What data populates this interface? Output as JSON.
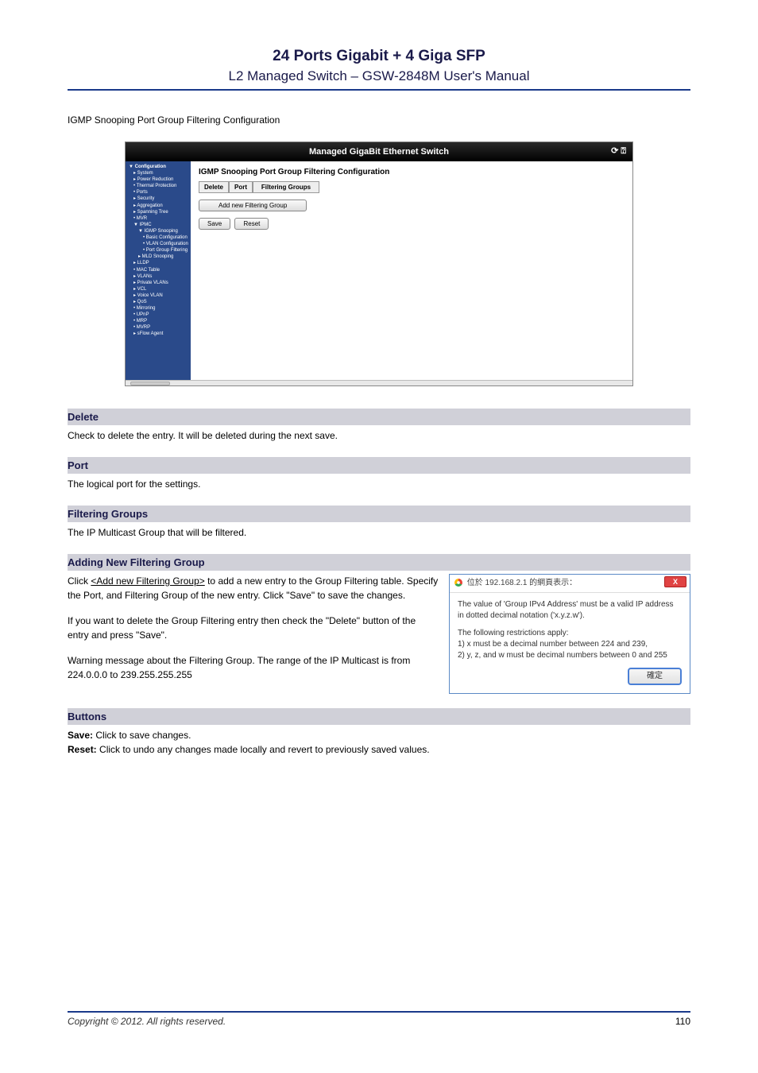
{
  "document": {
    "title": "24 Ports Gigabit + 4 Giga SFP",
    "subtitle": "L2 Managed Switch – GSW-2848M User's Manual",
    "intro": "IGMP Snooping Port Group Filtering Configuration",
    "footer_left": "Copyright © 2012. All rights reserved.",
    "footer_right": "110"
  },
  "switchui": {
    "header": "Managed GigaBit Ethernet Switch",
    "pane_title": "IGMP Snooping Port Group Filtering Configuration",
    "table": {
      "c1": "Delete",
      "c2": "Port",
      "c3": "Filtering Groups"
    },
    "btn_add": "Add new Filtering Group",
    "btn_save": "Save",
    "btn_reset": "Reset",
    "sidebar": [
      {
        "l": 1,
        "t": "▼ Configuration",
        "b": true
      },
      {
        "l": 2,
        "t": "▸ System"
      },
      {
        "l": 2,
        "t": "▸ Power Reduction"
      },
      {
        "l": 2,
        "t": "• Thermal Protection"
      },
      {
        "l": 2,
        "t": "• Ports"
      },
      {
        "l": 2,
        "t": "▸ Security"
      },
      {
        "l": 2,
        "t": "▸ Aggregation"
      },
      {
        "l": 2,
        "t": "▸ Spanning Tree"
      },
      {
        "l": 2,
        "t": "• MVR"
      },
      {
        "l": 2,
        "t": "▼ IPMC"
      },
      {
        "l": 3,
        "t": "▼ IGMP Snooping"
      },
      {
        "l": 4,
        "t": "• Basic Configuration"
      },
      {
        "l": 4,
        "t": "• VLAN Configuration"
      },
      {
        "l": 4,
        "t": "• Port Group Filtering"
      },
      {
        "l": 3,
        "t": "▸ MLD Snooping"
      },
      {
        "l": 2,
        "t": "▸ LLDP"
      },
      {
        "l": 2,
        "t": "• MAC Table"
      },
      {
        "l": 2,
        "t": "▸ VLANs"
      },
      {
        "l": 2,
        "t": "▸ Private VLANs"
      },
      {
        "l": 2,
        "t": "▸ VCL"
      },
      {
        "l": 2,
        "t": "▸ Voice VLAN"
      },
      {
        "l": 2,
        "t": "▸ QoS"
      },
      {
        "l": 2,
        "t": "• Mirroring"
      },
      {
        "l": 2,
        "t": "• UPnP"
      },
      {
        "l": 2,
        "t": "• MRP"
      },
      {
        "l": 2,
        "t": "• MVRP"
      },
      {
        "l": 2,
        "t": "▸ sFlow Agent"
      }
    ]
  },
  "sections": {
    "delete": {
      "h": "Delete",
      "t": "Check to delete the entry. It will be deleted during the next save."
    },
    "port": {
      "h": "Port",
      "t": "The logical port for the settings."
    },
    "fg": {
      "h": "Filtering Groups",
      "t": "The IP Multicast Group that will be filtered."
    },
    "add": {
      "h": "Adding New Filtering Group",
      "t1": "Click ",
      "link": "<Add new Filtering Group>",
      "t2": " to add a new entry to the Group Filtering table. Specify the Port, and Filtering Group of the new entry. Click \"Save\" to save the changes.",
      "t3": "If you want to delete the Group Filtering entry then check the \"Delete\" button of the entry and press \"Save\".",
      "warn": "Warning message about the Filtering Group. The range of the IP Multicast is from 224.0.0.0 to 239.255.255.255"
    },
    "buttons": {
      "h": "Buttons",
      "save_l": "Save:",
      "save_t": " Click to save changes.",
      "reset_l": "Reset:",
      "reset_t": " Click to undo any changes made locally and revert to previously saved values."
    }
  },
  "dialog": {
    "origin": "位於 192.168.2.1 的網頁表示：",
    "p1": "The value of 'Group IPv4 Address' must be a valid IP address in dotted decimal notation ('x.y.z.w').",
    "p2": "The following restrictions apply:",
    "r1": "  1) x must be a decimal number between 224 and 239,",
    "r2": "  2) y, z, and w must be decimal numbers between 0 and 255",
    "ok": "確定"
  }
}
